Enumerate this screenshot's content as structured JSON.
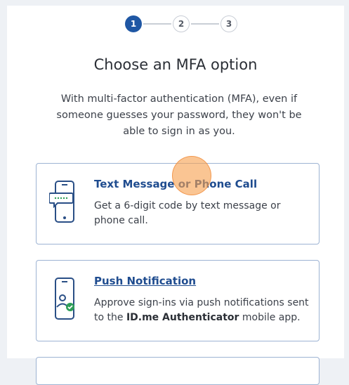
{
  "stepper": {
    "steps": [
      {
        "number": "1",
        "state": "active"
      },
      {
        "number": "2",
        "state": "inactive"
      },
      {
        "number": "3",
        "state": "inactive"
      }
    ]
  },
  "header": {
    "title": "Choose an MFA option",
    "subtitle": "With multi-factor authentication (MFA), even if someone guesses your password, they won't be able to sign in as you."
  },
  "options": [
    {
      "title": "Text Message or Phone Call",
      "description": "Get a 6-digit code by text message or phone call.",
      "icon": "phone-message-icon"
    },
    {
      "title": "Push Notification",
      "description_prefix": "Approve sign-ins via push notifications sent to the ",
      "description_bold": "ID.me Authenticator",
      "description_suffix": " mobile app.",
      "icon": "phone-user-check-icon"
    }
  ],
  "colors": {
    "accent": "#1f57a4",
    "link": "#1f4c8f",
    "card_border": "#9db3d3",
    "icon_stroke": "#2a4f86",
    "check_green": "#2e9e58",
    "click_marker": "#f7a250"
  }
}
